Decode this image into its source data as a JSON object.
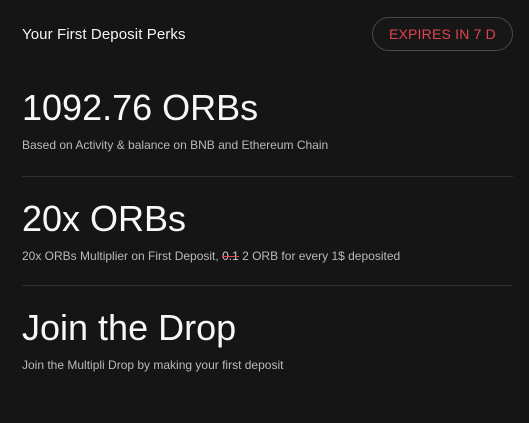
{
  "header": {
    "title": "Your First Deposit Perks",
    "expires_label": "EXPIRES IN 7 D"
  },
  "perks": [
    {
      "headline": "1092.76 ORBs",
      "description": "Based on Activity & balance on BNB and Ethereum Chain"
    },
    {
      "headline": "20x ORBs",
      "description_prefix": "20x ORBs Multiplier on First Deposit, ",
      "description_struck": "0.1",
      "description_suffix": " 2 ORB for every 1$ deposited"
    },
    {
      "headline": "Join the Drop",
      "description": "Join the Multipli Drop by making your first deposit"
    }
  ],
  "colors": {
    "background": "#151515",
    "accent_red": "#e0454f",
    "divider": "#2f2f2f",
    "text_primary": "#f7f7f7",
    "text_secondary": "#b9b9b9"
  }
}
